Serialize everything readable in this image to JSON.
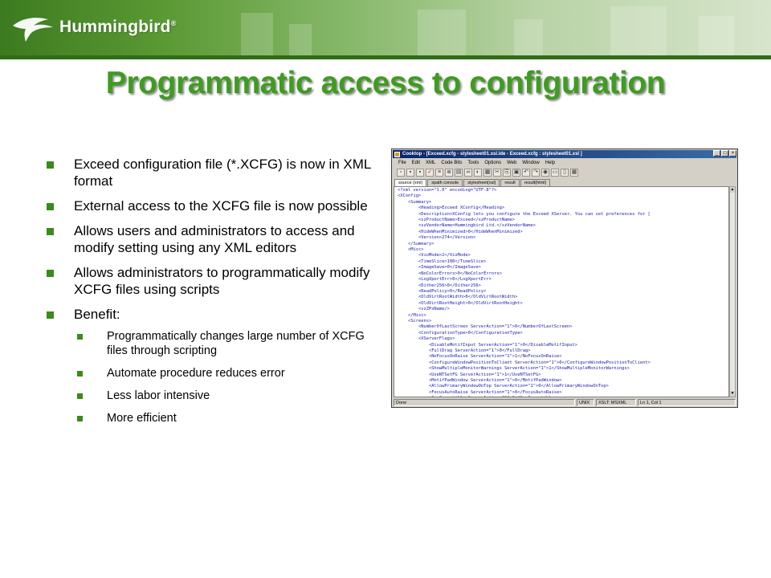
{
  "header": {
    "logo_text": "Hummingbird",
    "logo_mark": "®"
  },
  "title": "Programmatic access to configuration",
  "bullets": [
    {
      "text": "Exceed configuration file (*.XCFG) is now in XML format"
    },
    {
      "text": "External access to the XCFG file is now possible"
    },
    {
      "text": "Allows users and administrators to access and modify setting using any XML editors"
    },
    {
      "text": "Allows administrators to programmatically modify XCFG files using scripts"
    },
    {
      "text": "Benefit:"
    }
  ],
  "sub_bullets": [
    {
      "text": "Programmatically changes large number of XCFG files through scripting"
    },
    {
      "text": "Automate procedure reduces error"
    },
    {
      "text": "Less labor intensive"
    },
    {
      "text": "More efficient"
    }
  ],
  "window": {
    "title": "Cooktop - [Exceed.xcfg - stylesheet01.xsl.ide - Exceed.xcfg : stylesheet01.xsl ]",
    "menu": [
      "File",
      "Edit",
      "XML",
      "Code Bits",
      "Tools",
      "Options",
      "Web",
      "Window",
      "Help"
    ],
    "tabs": [
      "source (xml)",
      "xpath console",
      "stylesheet(xsl)",
      "result",
      "result(html)"
    ],
    "status": [
      "Done",
      "UNIX",
      "XSLT: MSXML",
      "Ln 1, Col 1"
    ],
    "code_lines": [
      "<?xml version=\"1.0\" encoding=\"UTF-8\"?>",
      "<XConfig>",
      "    <Summary>",
      "        <Heading>Exceed XConfig</Heading>",
      "        <Description>XConfig lets you configure the Exceed XServer. You can set preferences for [",
      "        <szProductName>Exceed</szProductName>",
      "        <szVendorName>Hummingbird Ltd.</szVendorName>",
      "        <HideWhenMinimized>0</HideWhenMinimized>",
      "        <Version>274</Version>",
      "    </Summary>",
      "    <Misc>",
      "        <VioMode>2</VioMode>",
      "        <TimeSlice>100</TimeSlice>",
      "        <ImageSave>0</ImageSave>",
      "        <NoColorErrors>0</NoColorErrors>",
      "        <LogXportErr>0</LogXportErr>",
      "        <Dither256>0</Dither256>",
      "        <ReadPolicy>0</ReadPolicy>",
      "        <OldVirtRootWidth>0</OldVirtRootWidth>",
      "        <OldVirtRootHeight>0</OldVirtRootHeight>",
      "        <szZPxName/>",
      "    </Misc>",
      "    <Screens>",
      "        <NumberOfLastScreen ServerAction=\"1\">0</NumberOfLastScreen>",
      "        <ConfigurationType>0</ConfigurationType>",
      "        <XServerFlags>",
      "            <DisableMotifInput ServerAction=\"1\">0</DisableMotifInput>",
      "            <FullDrag ServerAction=\"1\">0</FullDrag>",
      "            <NoFocusOnRaise ServerAction=\"1\">1</NoFocusOnRaise>",
      "            <ConfigureWindowPositionToClient ServerAction=\"1\">0</ConfigureWindowPositionToClient>",
      "            <ShowMultipleMonitorWarnings ServerAction=\"1\">1</ShowMultipleMonitorWarnings>",
      "            <UseNTSetFG ServerAction=\"1\">1</UseNTSetFG>",
      "            <MotifPadWindow ServerAction=\"1\">0</MotifPadWindow>",
      "            <AllowPrimaryWindowOnTop ServerAction=\"1\">0</AllowPrimaryWindowOnTop>",
      "            <FocusAutoRaise ServerAction=\"1\">0</FocusAutoRaise>",
      "            <SunCompatible ServerAction=\"1\">0</SunCompatible>",
      "            <UseInstalledColorMap ServerAction=\"1\">0</UseInstalledColorMap>"
    ]
  },
  "colors": {
    "title": "#3e9c1f",
    "bullet": "#3a8a1e",
    "banner": "#5c9a35"
  },
  "icons": [
    "hummingbird-logo-icon",
    "cooktop-app-icon",
    "minimize-icon",
    "maximize-icon",
    "close-icon"
  ]
}
